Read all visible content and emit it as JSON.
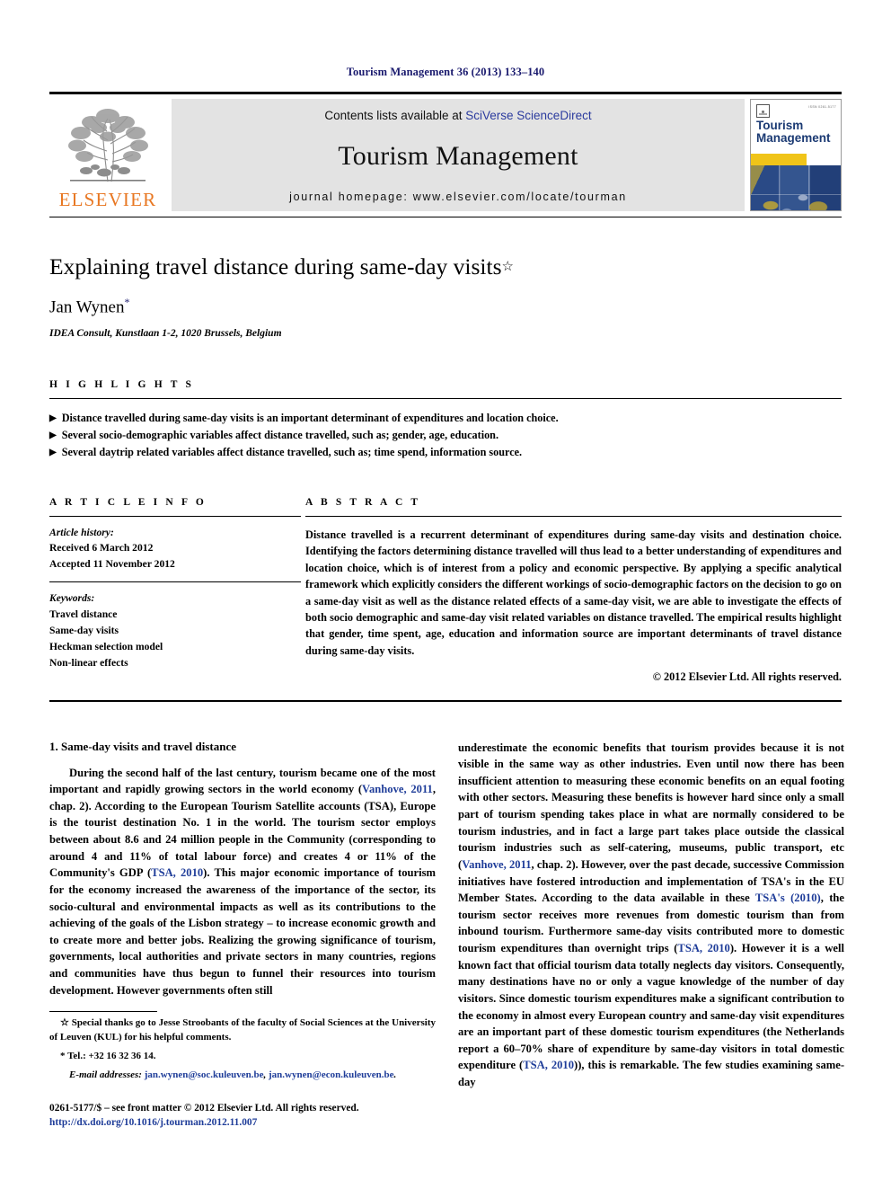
{
  "running_head": "Tourism Management 36 (2013) 133–140",
  "masthead": {
    "publisher_name": "ELSEVIER",
    "contents_prefix": "Contents lists available at ",
    "contents_link": "SciVerse ScienceDirect",
    "journal_name": "Tourism Management",
    "homepage": "journal homepage: www.elsevier.com/locate/tourman",
    "cover_title_line1": "Tourism",
    "cover_title_line2": "Management",
    "cover_mini_text": "ISSN 0261-5177"
  },
  "article": {
    "title": "Explaining travel distance during same-day visits",
    "title_footnote_mark": "☆",
    "author": "Jan Wynen",
    "author_footnote_mark": "*",
    "affiliation": "IDEA Consult, Kunstlaan 1-2, 1020 Brussels, Belgium"
  },
  "highlights": {
    "label": "H I G H L I G H T S",
    "bullet_glyph": "▶",
    "items": [
      "Distance travelled during same-day visits is an important determinant of expenditures and location choice.",
      "Several socio-demographic variables affect distance travelled, such as; gender, age, education.",
      "Several daytrip related variables affect distance travelled, such as; time spend, information source."
    ]
  },
  "article_info": {
    "label": "A R T I C L E   I N F O",
    "history_label": "Article history:",
    "received": "Received 6 March 2012",
    "accepted": "Accepted 11 November 2012",
    "keywords_label": "Keywords:",
    "keywords": [
      "Travel distance",
      "Same-day visits",
      "Heckman selection model",
      "Non-linear effects"
    ]
  },
  "abstract": {
    "label": "A B S T R A C T",
    "text": "Distance travelled is a recurrent determinant of expenditures during same-day visits and destination choice. Identifying the factors determining distance travelled will thus lead to a better understanding of expenditures and location choice, which is of interest from a policy and economic perspective. By applying a specific analytical framework which explicitly considers the different workings of socio-demographic factors on the decision to go on a same-day visit as well as the distance related effects of a same-day visit, we are able to investigate the effects of both socio demographic and same-day visit related variables on distance travelled. The empirical results highlight that gender, time spent, age, education and information source are important determinants of travel distance during same-day visits.",
    "copyright": "© 2012 Elsevier Ltd. All rights reserved."
  },
  "body": {
    "section_heading": "1. Same-day visits and travel distance",
    "left_paragraph_parts": [
      "During the second half of the last century, tourism became one of the most important and rapidly growing sectors in the world economy (",
      "Vanhove, 2011",
      ", chap. 2). According to the European Tourism Satellite accounts (TSA), Europe is the tourist destination No. 1 in the world. The tourism sector employs between about 8.6 and 24 million people in the Community (corresponding to around 4 and 11% of total labour force) and creates 4 or 11% of the Community's GDP (",
      "TSA, 2010",
      "). This major economic importance of tourism for the economy increased the awareness of the importance of the sector, its socio-cultural and environmental impacts as well as its contributions to the achieving of the goals of the Lisbon strategy – to increase economic growth and to create more and better jobs. Realizing the growing significance of tourism, governments, local authorities and private sectors in many countries, regions and communities have thus begun to funnel their resources into tourism development. However governments often still"
    ],
    "right_paragraph_parts": [
      "underestimate the economic benefits that tourism provides because it is not visible in the same way as other industries. Even until now there has been insufficient attention to measuring these economic benefits on an equal footing with other sectors. Measuring these benefits is however hard since only a small part of tourism spending takes place in what are normally considered to be tourism industries, and in fact a large part takes place outside the classical tourism industries such as self-catering, museums, public transport, etc (",
      "Vanhove, 2011",
      ", chap. 2). However, over the past decade, successive Commission initiatives have fostered introduction and implementation of TSA's in the EU Member States. According to the data available in these ",
      "TSA's (2010)",
      ", the tourism sector receives more revenues from domestic tourism than from inbound tourism. Furthermore same-day visits contributed more to domestic tourism expenditures than overnight trips (",
      "TSA, 2010",
      "). However it is a well known fact that official tourism data totally neglects day visitors. Consequently, many destinations have no or only a vague knowledge of the number of day visitors. Since domestic tourism expenditures make a significant contribution to the economy in almost every European country and same-day visit expenditures are an important part of these domestic tourism expenditures (the Netherlands report a 60–70% share of expenditure by same-day visitors in total domestic expenditure (",
      "TSA, 2010",
      ")), this is remarkable. The few studies examining same-day"
    ]
  },
  "footnotes": {
    "acknowledgement_mark": "☆",
    "acknowledgement": "Special thanks go to Jesse Stroobants of the faculty of Social Sciences at the University of Leuven (KUL) for his helpful comments.",
    "corresponding_mark": "*",
    "corresponding_tel": "Tel.: +32 16 32 36 14.",
    "email_label": "E-mail addresses:",
    "email_1": "jan.wynen@soc.kuleuven.be",
    "email_separator": ", ",
    "email_2": "jan.wynen@econ.kuleuven.be",
    "email_end": ".",
    "issn_line": "0261-5177/$ – see front matter © 2012 Elsevier Ltd. All rights reserved.",
    "doi": "http://dx.doi.org/10.1016/j.tourman.2012.11.007"
  },
  "colors": {
    "journal_navy": "#1a1a6e",
    "link_blue": "#1f3d99",
    "elsevier_orange": "#E87722",
    "cover_yellow": "#f0c419",
    "cover_navy": "#1b3a73",
    "contents_gray": "#e3e3e3"
  }
}
